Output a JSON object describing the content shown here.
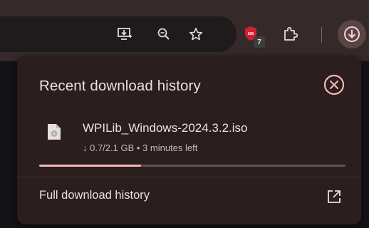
{
  "toolbar": {
    "icons": [
      "install-app-icon",
      "zoom-icon",
      "bookmark-star-icon",
      "extension-shield-icon",
      "extensions-puzzle-icon",
      "download-icon"
    ],
    "extension_badge": "7"
  },
  "popup": {
    "title": "Recent download history",
    "download": {
      "file_name": "WPILib_Windows-2024.3.2.iso",
      "status": "↓ 0.7/2.1 GB • 3 minutes left",
      "progress": 0.333
    },
    "footer_link": "Full download history"
  },
  "colors": {
    "accent": "#f1b8b2",
    "extension_shield": "#d01f2e"
  }
}
